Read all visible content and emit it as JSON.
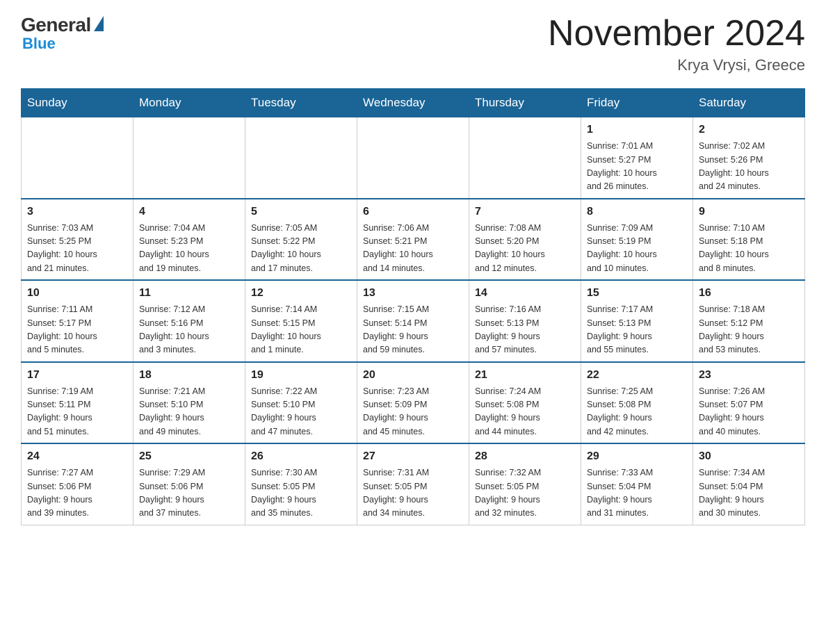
{
  "header": {
    "logo_general": "General",
    "logo_blue": "Blue",
    "main_title": "November 2024",
    "subtitle": "Krya Vrysi, Greece"
  },
  "calendar": {
    "days_of_week": [
      "Sunday",
      "Monday",
      "Tuesday",
      "Wednesday",
      "Thursday",
      "Friday",
      "Saturday"
    ],
    "weeks": [
      [
        {
          "day": "",
          "info": ""
        },
        {
          "day": "",
          "info": ""
        },
        {
          "day": "",
          "info": ""
        },
        {
          "day": "",
          "info": ""
        },
        {
          "day": "",
          "info": ""
        },
        {
          "day": "1",
          "info": "Sunrise: 7:01 AM\nSunset: 5:27 PM\nDaylight: 10 hours\nand 26 minutes."
        },
        {
          "day": "2",
          "info": "Sunrise: 7:02 AM\nSunset: 5:26 PM\nDaylight: 10 hours\nand 24 minutes."
        }
      ],
      [
        {
          "day": "3",
          "info": "Sunrise: 7:03 AM\nSunset: 5:25 PM\nDaylight: 10 hours\nand 21 minutes."
        },
        {
          "day": "4",
          "info": "Sunrise: 7:04 AM\nSunset: 5:23 PM\nDaylight: 10 hours\nand 19 minutes."
        },
        {
          "day": "5",
          "info": "Sunrise: 7:05 AM\nSunset: 5:22 PM\nDaylight: 10 hours\nand 17 minutes."
        },
        {
          "day": "6",
          "info": "Sunrise: 7:06 AM\nSunset: 5:21 PM\nDaylight: 10 hours\nand 14 minutes."
        },
        {
          "day": "7",
          "info": "Sunrise: 7:08 AM\nSunset: 5:20 PM\nDaylight: 10 hours\nand 12 minutes."
        },
        {
          "day": "8",
          "info": "Sunrise: 7:09 AM\nSunset: 5:19 PM\nDaylight: 10 hours\nand 10 minutes."
        },
        {
          "day": "9",
          "info": "Sunrise: 7:10 AM\nSunset: 5:18 PM\nDaylight: 10 hours\nand 8 minutes."
        }
      ],
      [
        {
          "day": "10",
          "info": "Sunrise: 7:11 AM\nSunset: 5:17 PM\nDaylight: 10 hours\nand 5 minutes."
        },
        {
          "day": "11",
          "info": "Sunrise: 7:12 AM\nSunset: 5:16 PM\nDaylight: 10 hours\nand 3 minutes."
        },
        {
          "day": "12",
          "info": "Sunrise: 7:14 AM\nSunset: 5:15 PM\nDaylight: 10 hours\nand 1 minute."
        },
        {
          "day": "13",
          "info": "Sunrise: 7:15 AM\nSunset: 5:14 PM\nDaylight: 9 hours\nand 59 minutes."
        },
        {
          "day": "14",
          "info": "Sunrise: 7:16 AM\nSunset: 5:13 PM\nDaylight: 9 hours\nand 57 minutes."
        },
        {
          "day": "15",
          "info": "Sunrise: 7:17 AM\nSunset: 5:13 PM\nDaylight: 9 hours\nand 55 minutes."
        },
        {
          "day": "16",
          "info": "Sunrise: 7:18 AM\nSunset: 5:12 PM\nDaylight: 9 hours\nand 53 minutes."
        }
      ],
      [
        {
          "day": "17",
          "info": "Sunrise: 7:19 AM\nSunset: 5:11 PM\nDaylight: 9 hours\nand 51 minutes."
        },
        {
          "day": "18",
          "info": "Sunrise: 7:21 AM\nSunset: 5:10 PM\nDaylight: 9 hours\nand 49 minutes."
        },
        {
          "day": "19",
          "info": "Sunrise: 7:22 AM\nSunset: 5:10 PM\nDaylight: 9 hours\nand 47 minutes."
        },
        {
          "day": "20",
          "info": "Sunrise: 7:23 AM\nSunset: 5:09 PM\nDaylight: 9 hours\nand 45 minutes."
        },
        {
          "day": "21",
          "info": "Sunrise: 7:24 AM\nSunset: 5:08 PM\nDaylight: 9 hours\nand 44 minutes."
        },
        {
          "day": "22",
          "info": "Sunrise: 7:25 AM\nSunset: 5:08 PM\nDaylight: 9 hours\nand 42 minutes."
        },
        {
          "day": "23",
          "info": "Sunrise: 7:26 AM\nSunset: 5:07 PM\nDaylight: 9 hours\nand 40 minutes."
        }
      ],
      [
        {
          "day": "24",
          "info": "Sunrise: 7:27 AM\nSunset: 5:06 PM\nDaylight: 9 hours\nand 39 minutes."
        },
        {
          "day": "25",
          "info": "Sunrise: 7:29 AM\nSunset: 5:06 PM\nDaylight: 9 hours\nand 37 minutes."
        },
        {
          "day": "26",
          "info": "Sunrise: 7:30 AM\nSunset: 5:05 PM\nDaylight: 9 hours\nand 35 minutes."
        },
        {
          "day": "27",
          "info": "Sunrise: 7:31 AM\nSunset: 5:05 PM\nDaylight: 9 hours\nand 34 minutes."
        },
        {
          "day": "28",
          "info": "Sunrise: 7:32 AM\nSunset: 5:05 PM\nDaylight: 9 hours\nand 32 minutes."
        },
        {
          "day": "29",
          "info": "Sunrise: 7:33 AM\nSunset: 5:04 PM\nDaylight: 9 hours\nand 31 minutes."
        },
        {
          "day": "30",
          "info": "Sunrise: 7:34 AM\nSunset: 5:04 PM\nDaylight: 9 hours\nand 30 minutes."
        }
      ]
    ]
  }
}
